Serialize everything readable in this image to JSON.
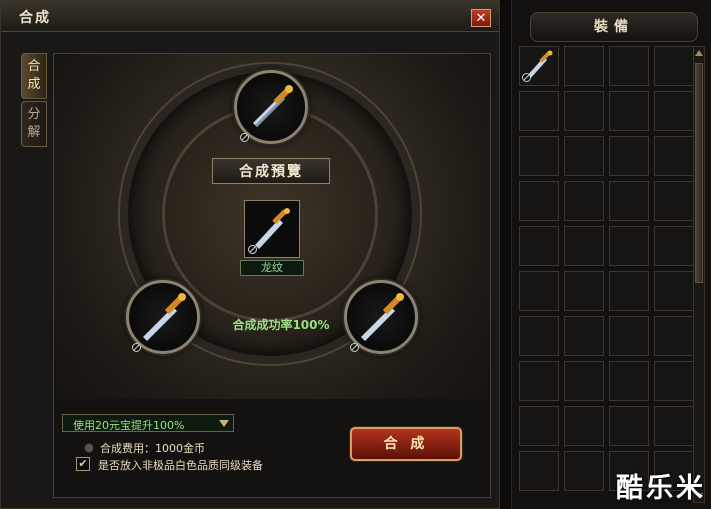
{
  "window": {
    "title": "合成",
    "close_glyph": "✕"
  },
  "tabs": [
    {
      "label": "合成"
    },
    {
      "label": "分解"
    }
  ],
  "preview": {
    "banner": "合成預覽",
    "result_name": "龙纹",
    "success_rate": "合成成功率100%"
  },
  "options": {
    "dropdown_value": "使用20元宝提升100%",
    "cost_text": "合成费用：1000金币",
    "checkbox_label": "是否放入非极品白色品质同级装备",
    "checkbox_checked": true
  },
  "buttons": {
    "merge_label": "合 成"
  },
  "inventory": {
    "title": "裝備",
    "rows": 10,
    "cols": 4,
    "occupied_slots": [
      0
    ]
  },
  "watermark": "酷乐米",
  "icons": [
    "close-icon",
    "sword-icon",
    "bound-icon",
    "dropdown-arrow-icon",
    "coin-icon",
    "check-icon",
    "scroll-up-icon",
    "scroll-down-icon"
  ]
}
